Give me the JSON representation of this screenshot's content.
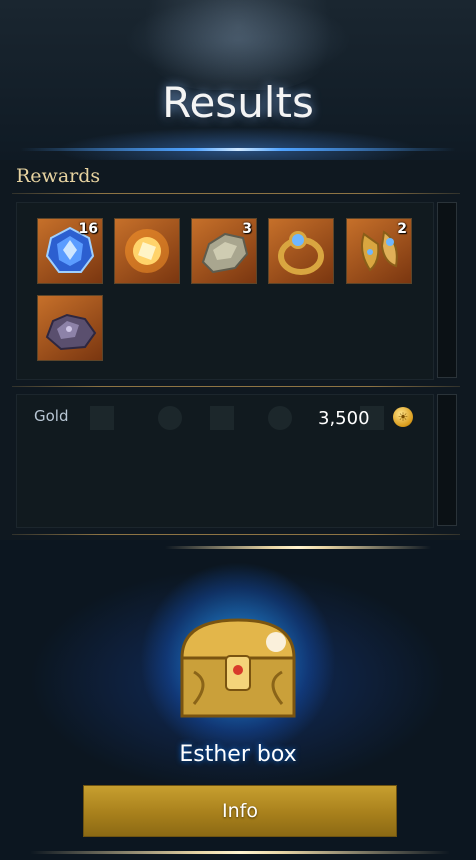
{
  "header": {
    "title": "Results"
  },
  "rewards": {
    "label": "Rewards",
    "items": [
      {
        "name": "blue-gem-icon",
        "quantity": "16"
      },
      {
        "name": "glowing-orb-icon",
        "quantity": ""
      },
      {
        "name": "stone-chunk-icon",
        "quantity": "3"
      },
      {
        "name": "jeweled-ring-icon",
        "quantity": ""
      },
      {
        "name": "jeweled-earrings-icon",
        "quantity": "2"
      },
      {
        "name": "purple-ore-icon",
        "quantity": ""
      }
    ]
  },
  "gold": {
    "label": "Gold",
    "value": "3,500",
    "icon": "gold-coin-icon"
  },
  "reward_box": {
    "name": "Esther box",
    "button_label": "Info"
  },
  "colors": {
    "slot_orange": "#c6702a",
    "accent_gold": "#b38a24",
    "glow_blue": "#2aa8ff"
  }
}
